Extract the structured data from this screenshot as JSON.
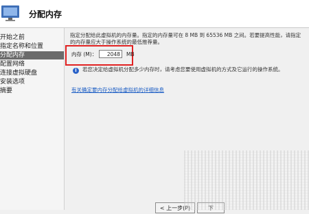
{
  "wizard": {
    "title": "分配内存"
  },
  "sidebar": {
    "items": [
      {
        "label": "开始之前",
        "active": false
      },
      {
        "label": "指定名称和位置",
        "active": false
      },
      {
        "label": "分配内存",
        "active": true
      },
      {
        "label": "配置网络",
        "active": false
      },
      {
        "label": "连接虚拟硬盘",
        "active": false
      },
      {
        "label": "安装选项",
        "active": false
      },
      {
        "label": "摘要",
        "active": false
      }
    ]
  },
  "main": {
    "description": "指定分配给此虚拟机的内存量。指定的内存量可在 8 MB 到 65536 MB 之间。若要提高性能，请指定的内存量应大于操作系统的最低推荐量。",
    "memory_label": "内存 (M)：",
    "memory_value": "2048",
    "memory_unit": "MB",
    "info_text": "若您决定给虚拟机分配多少内存时，请考虑您要使用虚拟机的方式及它运行的操作系统。",
    "help_link": "有关确定要内存分配给虚拟机的详细信息"
  },
  "buttons": {
    "prev": "< 上一步(P)",
    "next": "下"
  },
  "colors": {
    "highlight": "#e02020",
    "link": "#1a5cc4",
    "active_item": "#6b6b6b"
  }
}
